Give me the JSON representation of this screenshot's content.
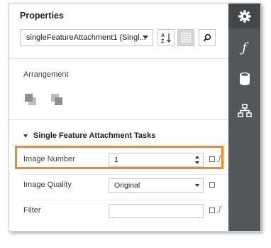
{
  "panel": {
    "title": "Properties",
    "component_select": "singleFeatureAttachment1 (Singl...",
    "arrangement_label": "Arrangement",
    "group_title": "Single Feature Attachment Tasks"
  },
  "toolbar": {
    "sort_icon": "sort-az-icon",
    "categories_icon": "categories-icon",
    "search_icon": "search-icon"
  },
  "rail": {
    "icons": [
      "gear-icon",
      "function-icon",
      "database-icon",
      "hierarchy-icon"
    ]
  },
  "properties": [
    {
      "label": "Image Number",
      "value": "1",
      "type": "number"
    },
    {
      "label": "Image Quality",
      "value": "Original",
      "type": "dropdown"
    },
    {
      "label": "Filter",
      "value": "",
      "type": "text"
    }
  ],
  "colors": {
    "highlight": "#f08a1e",
    "rail": "#52575c"
  }
}
